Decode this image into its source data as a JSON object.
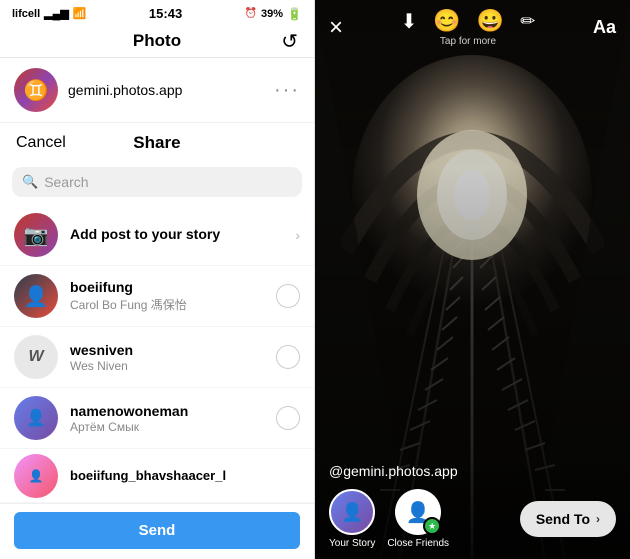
{
  "statusBar": {
    "carrier": "lifcell",
    "time": "15:43",
    "battery": "39%"
  },
  "left": {
    "navTitle": "Photo",
    "backIcon": "↺",
    "profile": {
      "name": "gemini.photos.app",
      "avatar": "♊"
    },
    "shareBar": {
      "cancelLabel": "Cancel",
      "shareLabel": "Share"
    },
    "search": {
      "placeholder": "Search",
      "plusIcon": "+"
    },
    "items": [
      {
        "id": "story",
        "name": "Add post to your story",
        "sub": "",
        "avatarEmoji": "📷",
        "avatarStyle": "story",
        "action": "chevron"
      },
      {
        "id": "boeiifung",
        "name": "boeiifung",
        "sub": "Carol Bo Fung 馮保怡",
        "avatarEmoji": "👤",
        "avatarStyle": "boei",
        "action": "circle"
      },
      {
        "id": "wesniven",
        "name": "wesniven",
        "sub": "Wes Niven",
        "avatarEmoji": "W",
        "avatarStyle": "wes",
        "action": "circle"
      },
      {
        "id": "namenowoneman",
        "name": "namenowoneman",
        "sub": "Артём Смык",
        "avatarEmoji": "👤",
        "avatarStyle": "name",
        "action": "circle"
      },
      {
        "id": "boeiifung2",
        "name": "boeiifung_bhavshaacer_l",
        "sub": "",
        "avatarEmoji": "👤",
        "avatarStyle": "last",
        "action": "circle"
      }
    ],
    "sendButton": "Send"
  },
  "right": {
    "closeIcon": "×",
    "toolbar": {
      "tapForMore": "Tap for more",
      "downloadIcon": "⬇",
      "smileyIcon": "😊",
      "stickerIcon": "😀",
      "penIcon": "✏",
      "aaLabel": "Aa"
    },
    "usernameTag": "@gemini.photos.app",
    "bottom": {
      "yourStoryLabel": "Your Story",
      "closeFriendsLabel": "Close Friends",
      "sendToLabel": "Send To",
      "sendToChevron": "›"
    }
  }
}
